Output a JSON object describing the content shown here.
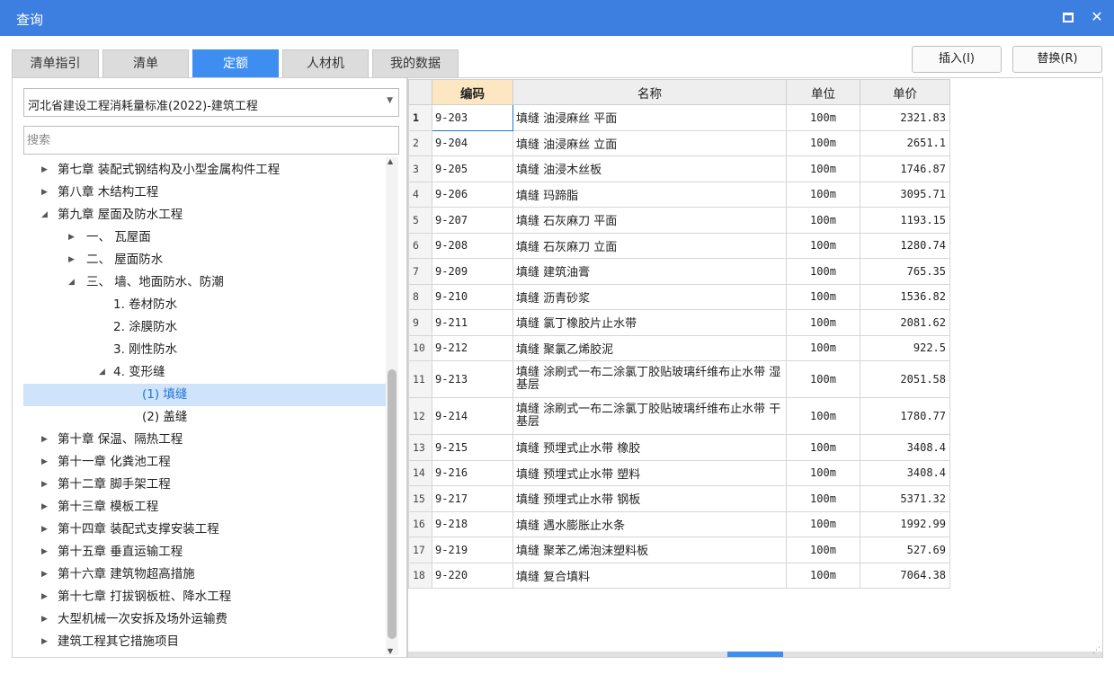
{
  "window": {
    "title": "查询"
  },
  "tabs": [
    "清单指引",
    "清单",
    "定额",
    "人材机",
    "我的数据"
  ],
  "buttons": {
    "insert": "插入(I)",
    "replace": "替换(R)"
  },
  "standard_select": {
    "value": "河北省建设工程消耗量标准(2022)-建筑工程"
  },
  "search": {
    "placeholder": "搜索"
  },
  "tree": [
    {
      "label": "第七章 装配式钢结构及小型金属构件工程",
      "level": 0,
      "state": "collapsed"
    },
    {
      "label": "第八章 木结构工程",
      "level": 0,
      "state": "collapsed"
    },
    {
      "label": "第九章 屋面及防水工程",
      "level": 0,
      "state": "expanded"
    },
    {
      "label": "一、 瓦屋面",
      "level": 1,
      "state": "collapsed"
    },
    {
      "label": "二、 屋面防水",
      "level": 1,
      "state": "collapsed"
    },
    {
      "label": "三、 墙、地面防水、防潮",
      "level": 1,
      "state": "expanded"
    },
    {
      "label": "1. 卷材防水",
      "level": 2,
      "state": "leaf"
    },
    {
      "label": "2. 涂膜防水",
      "level": 2,
      "state": "leaf"
    },
    {
      "label": "3. 刚性防水",
      "level": 2,
      "state": "leaf"
    },
    {
      "label": "4. 变形缝",
      "level": 2,
      "state": "expanded"
    },
    {
      "label": "(1) 填缝",
      "level": 3,
      "state": "leaf",
      "selected": true
    },
    {
      "label": "(2) 盖缝",
      "level": 3,
      "state": "leaf"
    },
    {
      "label": "第十章 保温、隔热工程",
      "level": 0,
      "state": "collapsed"
    },
    {
      "label": "第十一章 化粪池工程",
      "level": 0,
      "state": "collapsed"
    },
    {
      "label": "第十二章 脚手架工程",
      "level": 0,
      "state": "collapsed"
    },
    {
      "label": "第十三章 模板工程",
      "level": 0,
      "state": "collapsed"
    },
    {
      "label": "第十四章 装配式支撑安装工程",
      "level": 0,
      "state": "collapsed"
    },
    {
      "label": "第十五章 垂直运输工程",
      "level": 0,
      "state": "collapsed"
    },
    {
      "label": "第十六章 建筑物超高措施",
      "level": 0,
      "state": "collapsed"
    },
    {
      "label": "第十七章 打拔钢板桩、降水工程",
      "level": 0,
      "state": "collapsed"
    },
    {
      "label": "大型机械一次安拆及场外运输费",
      "level": 0,
      "state": "collapsed"
    },
    {
      "label": "建筑工程其它措施项目",
      "level": 0,
      "state": "collapsed"
    }
  ],
  "table": {
    "headers": {
      "code": "编码",
      "name": "名称",
      "unit": "单位",
      "price": "单价"
    },
    "rows": [
      {
        "n": "1",
        "code": "9-203",
        "name": "填缝 油浸麻丝 平面",
        "unit": "100m",
        "price": "2321.83"
      },
      {
        "n": "2",
        "code": "9-204",
        "name": "填缝 油浸麻丝 立面",
        "unit": "100m",
        "price": "2651.1"
      },
      {
        "n": "3",
        "code": "9-205",
        "name": "填缝 油浸木丝板",
        "unit": "100m",
        "price": "1746.87"
      },
      {
        "n": "4",
        "code": "9-206",
        "name": "填缝 玛蹄脂",
        "unit": "100m",
        "price": "3095.71"
      },
      {
        "n": "5",
        "code": "9-207",
        "name": "填缝 石灰麻刀 平面",
        "unit": "100m",
        "price": "1193.15"
      },
      {
        "n": "6",
        "code": "9-208",
        "name": "填缝 石灰麻刀 立面",
        "unit": "100m",
        "price": "1280.74"
      },
      {
        "n": "7",
        "code": "9-209",
        "name": "填缝 建筑油膏",
        "unit": "100m",
        "price": "765.35"
      },
      {
        "n": "8",
        "code": "9-210",
        "name": "填缝 沥青砂浆",
        "unit": "100m",
        "price": "1536.82"
      },
      {
        "n": "9",
        "code": "9-211",
        "name": "填缝 氯丁橡胶片止水带",
        "unit": "100m",
        "price": "2081.62"
      },
      {
        "n": "10",
        "code": "9-212",
        "name": "填缝 聚氯乙烯胶泥",
        "unit": "100m",
        "price": "922.5"
      },
      {
        "n": "11",
        "code": "9-213",
        "name": "填缝 涂刷式一布二涂氯丁胶贴玻璃纤维布止水带 湿基层",
        "unit": "100m",
        "price": "2051.58"
      },
      {
        "n": "12",
        "code": "9-214",
        "name": "填缝 涂刷式一布二涂氯丁胶贴玻璃纤维布止水带 干基层",
        "unit": "100m",
        "price": "1780.77"
      },
      {
        "n": "13",
        "code": "9-215",
        "name": "填缝 预埋式止水带 橡胶",
        "unit": "100m",
        "price": "3408.4"
      },
      {
        "n": "14",
        "code": "9-216",
        "name": "填缝 预埋式止水带 塑料",
        "unit": "100m",
        "price": "3408.4"
      },
      {
        "n": "15",
        "code": "9-217",
        "name": "填缝 预埋式止水带 钢板",
        "unit": "100m",
        "price": "5371.32"
      },
      {
        "n": "16",
        "code": "9-218",
        "name": "填缝 遇水膨胀止水条",
        "unit": "100m",
        "price": "1992.99"
      },
      {
        "n": "17",
        "code": "9-219",
        "name": "填缝 聚苯乙烯泡沫塑料板",
        "unit": "100m",
        "price": "527.69"
      },
      {
        "n": "18",
        "code": "9-220",
        "name": "填缝 复合填料",
        "unit": "100m",
        "price": "7064.38"
      }
    ]
  },
  "colors": {
    "titlebar": "#3d7fe0",
    "active_tab": "#3d8ef0",
    "selection": "#cfe3fa",
    "code_header": "#fde6c2"
  },
  "icons": {
    "maximize": "maximize-icon",
    "close": "close-icon"
  }
}
